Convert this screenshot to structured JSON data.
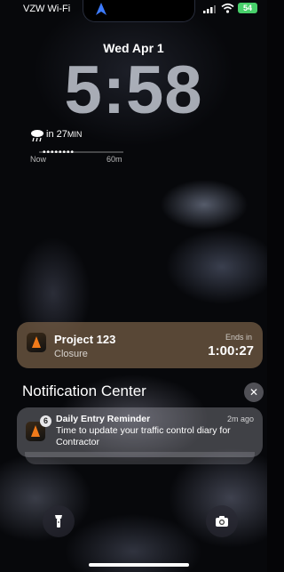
{
  "status": {
    "carrier": "VZW Wi-Fi",
    "battery": "54"
  },
  "lock": {
    "date": "Wed Apr 1",
    "time": "5:58"
  },
  "weather": {
    "icon": "rain-cloud-icon",
    "prefix": "in 27",
    "unit": "MIN",
    "left": "Now",
    "right": "60m"
  },
  "live_activity": {
    "title": "Project 123",
    "subtitle": "Closure",
    "ends_label": "Ends in",
    "countdown": "1:00:27"
  },
  "notification_center": {
    "title": "Notification Center",
    "close": "✕"
  },
  "notification": {
    "count": "6",
    "title": "Daily Entry Reminder",
    "time": "2m ago",
    "body": "Time to update your traffic control diary for Contractor"
  },
  "quick_actions": {
    "left": "flashlight-icon",
    "right": "camera-icon"
  },
  "colors": {
    "battery": "#48d06b",
    "activity": "#785f46",
    "cone": "#f07a1a"
  }
}
